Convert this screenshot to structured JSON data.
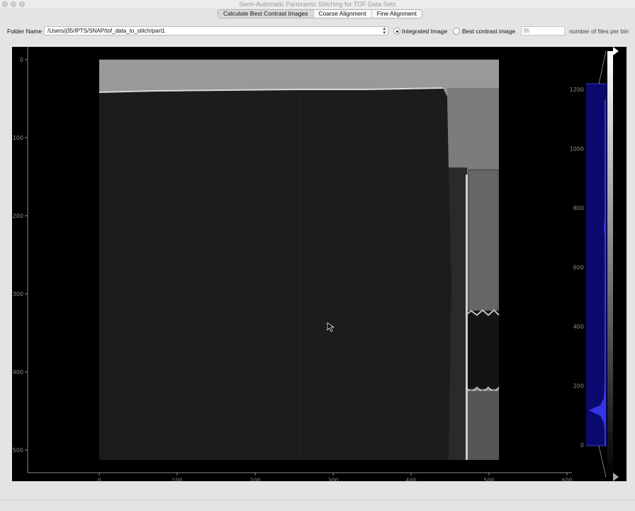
{
  "window": {
    "title": "Semi-Automatic Panoramic Stitching for TOF Data Sets"
  },
  "tabs": [
    {
      "label": "Calculate Best Contrast Images",
      "active": true
    },
    {
      "label": "Coarse Alignment",
      "active": false
    },
    {
      "label": "Fine Alignment",
      "active": false
    }
  ],
  "toolbar": {
    "folder_label": "Folder Name",
    "folder_value": "/Users/j35/IPTS/SNAP/tof_data_to_stitch/part1",
    "radio_integrated_label": "Integrated Image",
    "radio_integrated_checked": true,
    "radio_best_label": "Best contrast image",
    "radio_best_checked": false,
    "files_per_bin_value": "36",
    "files_per_bin_label": "number of files per bin"
  },
  "image_view": {
    "x_ticks": [
      "0",
      "100",
      "200",
      "300",
      "400",
      "500",
      "600"
    ],
    "y_ticks": [
      "0",
      "100",
      "200",
      "300",
      "400",
      "500"
    ]
  },
  "histogram": {
    "ticks": [
      "1200",
      "1000",
      "800",
      "600",
      "400",
      "200",
      "0"
    ],
    "fill_color": "#2a2ae0",
    "region_color": "#0a0a6e"
  },
  "colors": {
    "background": "#000000",
    "axis": "#8c8c8c",
    "window": "#e4e4e4"
  }
}
